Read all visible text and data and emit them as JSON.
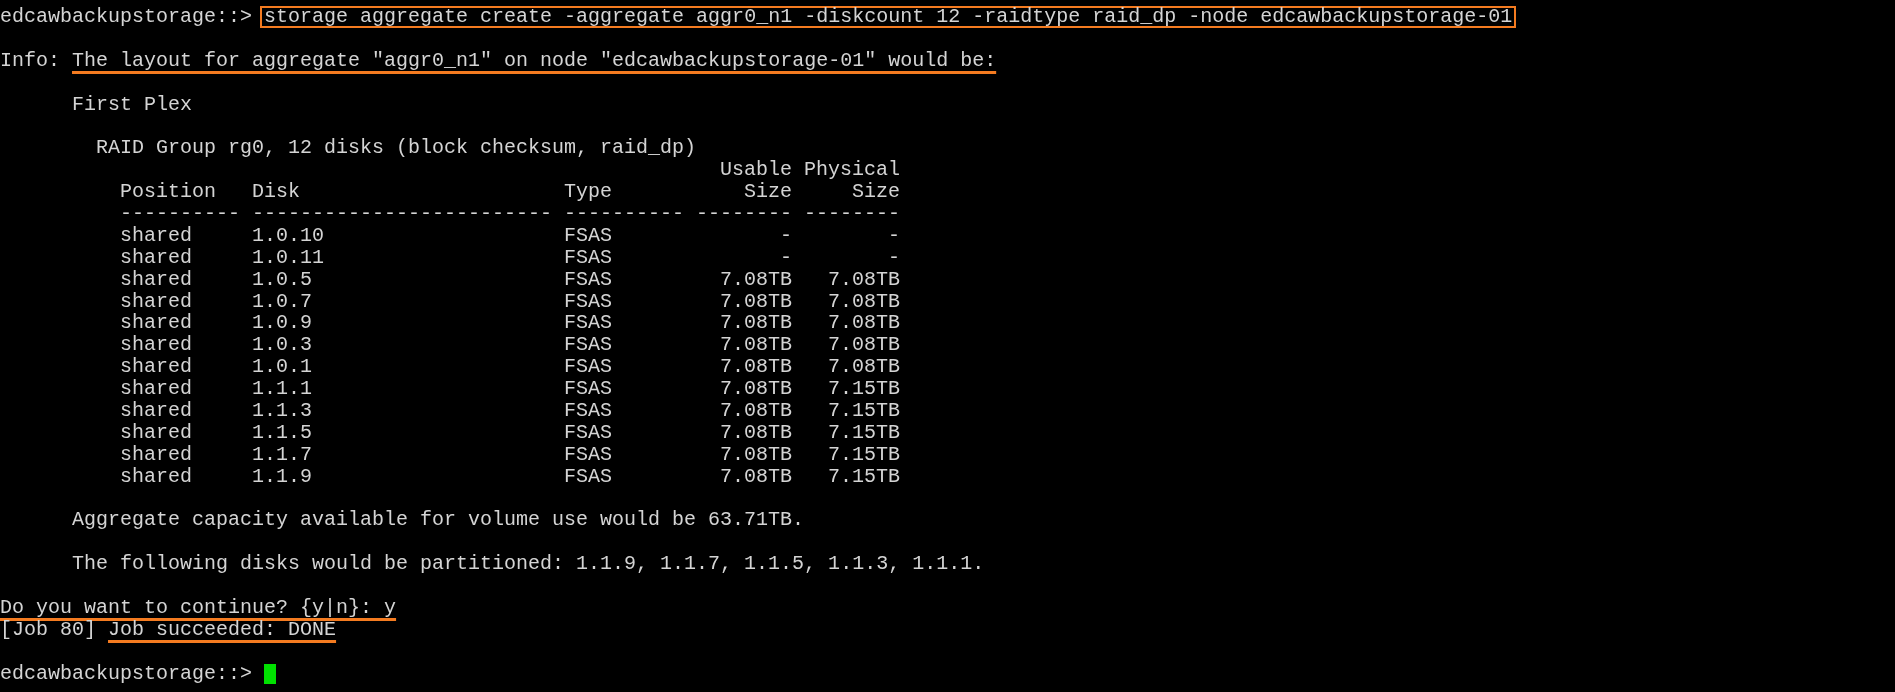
{
  "command": {
    "prompt": "edcawbackupstorage::>",
    "text": "storage aggregate create -aggregate aggr0_n1 -diskcount 12 -raidtype raid_dp -node edcawbackupstorage-01",
    "boxed": true
  },
  "info": {
    "label": "Info:",
    "text": "The layout for aggregate \"aggr0_n1\" on node \"edcawbackupstorage-01\" would be:",
    "underlined": true
  },
  "plex_title": "First Plex",
  "raid_group": "RAID Group rg0, 12 disks (block checksum, raid_dp)",
  "table": {
    "columns": [
      {
        "header": "Position",
        "rule": "----------"
      },
      {
        "header": "Disk",
        "rule": "-------------------------"
      },
      {
        "header": "Type",
        "rule": "----------"
      },
      {
        "header_top": "Usable",
        "header": "Size",
        "rule": "--------"
      },
      {
        "header_top": "Physical",
        "header": "Size",
        "rule": "--------"
      }
    ],
    "rows": [
      [
        "shared",
        "1.0.10",
        "FSAS",
        "-",
        "-"
      ],
      [
        "shared",
        "1.0.11",
        "FSAS",
        "-",
        "-"
      ],
      [
        "shared",
        "1.0.5",
        "FSAS",
        "7.08TB",
        "7.08TB"
      ],
      [
        "shared",
        "1.0.7",
        "FSAS",
        "7.08TB",
        "7.08TB"
      ],
      [
        "shared",
        "1.0.9",
        "FSAS",
        "7.08TB",
        "7.08TB"
      ],
      [
        "shared",
        "1.0.3",
        "FSAS",
        "7.08TB",
        "7.08TB"
      ],
      [
        "shared",
        "1.0.1",
        "FSAS",
        "7.08TB",
        "7.08TB"
      ],
      [
        "shared",
        "1.1.1",
        "FSAS",
        "7.08TB",
        "7.15TB"
      ],
      [
        "shared",
        "1.1.3",
        "FSAS",
        "7.08TB",
        "7.15TB"
      ],
      [
        "shared",
        "1.1.5",
        "FSAS",
        "7.08TB",
        "7.15TB"
      ],
      [
        "shared",
        "1.1.7",
        "FSAS",
        "7.08TB",
        "7.15TB"
      ],
      [
        "shared",
        "1.1.9",
        "FSAS",
        "7.08TB",
        "7.15TB"
      ]
    ]
  },
  "capacity_note": "Aggregate capacity available for volume use would be 63.71TB.",
  "partition_note": "The following disks would be partitioned: 1.1.9, 1.1.7, 1.1.5, 1.1.3, 1.1.1.",
  "confirm": {
    "text": "Do you want to continue? {y|n}: y",
    "underlined": true
  },
  "job": {
    "id": "[Job 80]",
    "text": "Job succeeded: DONE",
    "underlined": true
  },
  "prompt": {
    "text": "edcawbackupstorage::>",
    "cursor": true
  }
}
